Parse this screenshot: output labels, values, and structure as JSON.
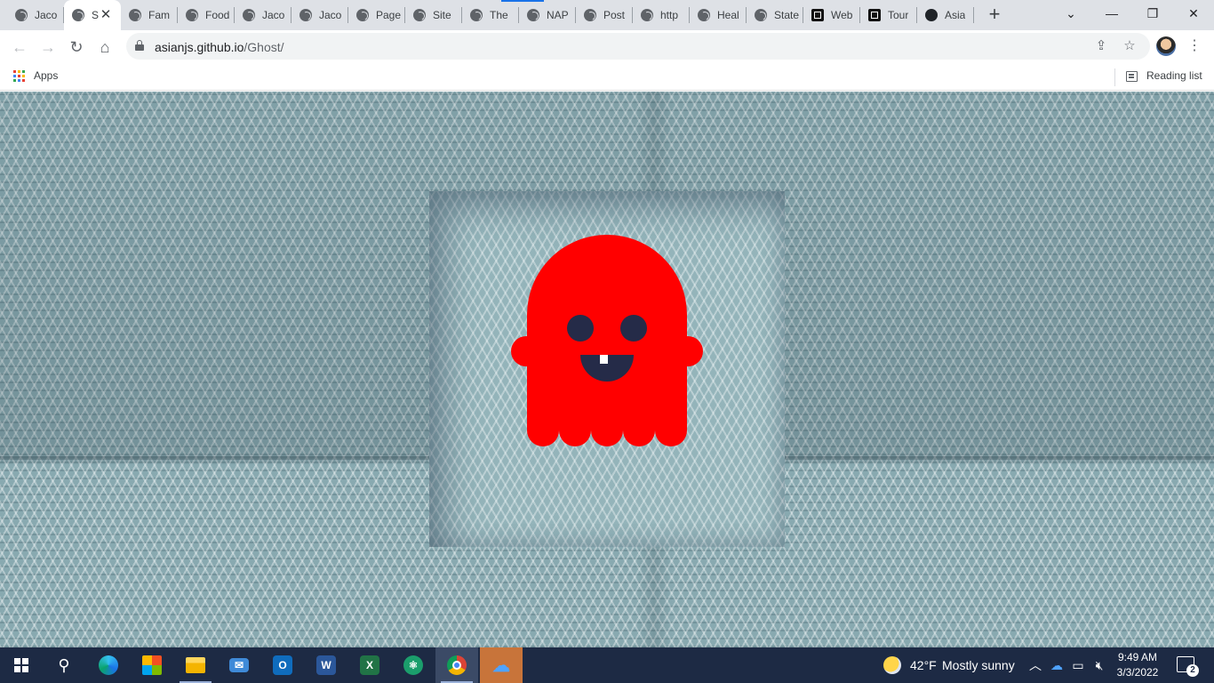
{
  "browser": {
    "tabs": [
      {
        "title": "Jaco",
        "icon": "globe-icon"
      },
      {
        "title": "S",
        "icon": "globe-icon",
        "active": true
      },
      {
        "title": "Fam",
        "icon": "globe-icon"
      },
      {
        "title": "Food",
        "icon": "globe-icon"
      },
      {
        "title": "Jaco",
        "icon": "globe-icon"
      },
      {
        "title": "Jaco",
        "icon": "globe-icon"
      },
      {
        "title": "Page",
        "icon": "globe-icon"
      },
      {
        "title": "Site",
        "icon": "globe-icon"
      },
      {
        "title": "The",
        "icon": "globe-icon"
      },
      {
        "title": "NAP",
        "icon": "globe-icon"
      },
      {
        "title": "Post",
        "icon": "globe-icon"
      },
      {
        "title": "http",
        "icon": "globe-icon"
      },
      {
        "title": "Heal",
        "icon": "globe-icon"
      },
      {
        "title": "State",
        "icon": "globe-icon"
      },
      {
        "title": "Web",
        "icon": "square-logo-icon"
      },
      {
        "title": "Tour",
        "icon": "square-logo-icon"
      },
      {
        "title": "Asia",
        "icon": "github-icon"
      }
    ],
    "tab_close_glyph": "✕",
    "new_tab_glyph": "+",
    "window_controls": {
      "tab_search": "⌄",
      "minimize": "—",
      "restore": "❐",
      "close": "✕"
    },
    "address": {
      "host": "asianjs.github.io",
      "path": "/Ghost/"
    },
    "bookmarks": {
      "apps_label": "Apps",
      "reading_list_label": "Reading list"
    },
    "accent_color": "#1a73e8"
  },
  "page": {
    "ghost_color": "#ff0000",
    "feature_color": "#252b48",
    "tooth_color": "#ffffff",
    "background_color": "#88a9b0"
  },
  "taskbar": {
    "apps": [
      "windows-start",
      "search",
      "edge",
      "microsoft-store",
      "file-explorer",
      "mail",
      "outlook",
      "word",
      "excel",
      "atom",
      "chrome",
      "onedrive"
    ],
    "weather": {
      "temperature": "42°F",
      "condition": "Mostly sunny"
    },
    "clock": {
      "time": "9:49 AM",
      "date": "3/3/2022"
    },
    "notification_count": "2"
  }
}
